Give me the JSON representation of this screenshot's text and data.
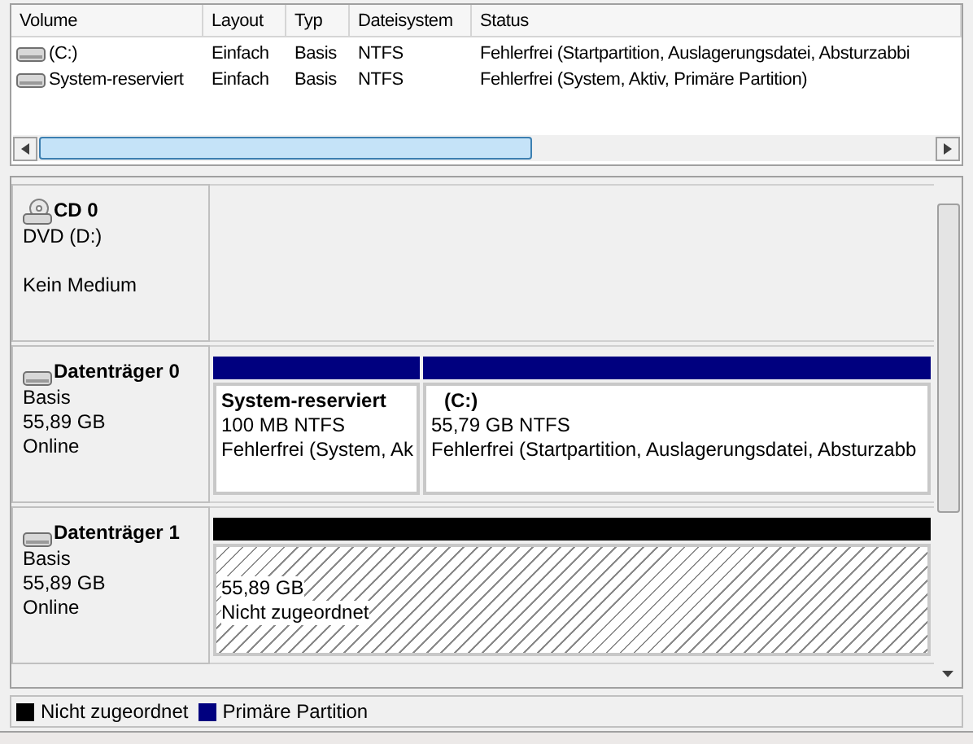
{
  "volume_list": {
    "columns": [
      "Volume",
      "Layout",
      "Typ",
      "Dateisystem",
      "Status"
    ],
    "rows": [
      [
        "(C:)",
        "Einfach",
        "Basis",
        "NTFS",
        "Fehlerfrei (Startpartition, Auslagerungsdatei, Absturzabbi"
      ],
      [
        "System-reserviert",
        "Einfach",
        "Basis",
        "NTFS",
        "Fehlerfrei (System, Aktiv, Primäre Partition)"
      ]
    ]
  },
  "disks": [
    {
      "kind": "cdrom",
      "name": "CD 0",
      "lines": [
        "DVD (D:)",
        "Kein Medium"
      ]
    },
    {
      "kind": "disk",
      "name": "Datenträger 0",
      "lines": [
        "Basis",
        "55,89 GB",
        "Online"
      ],
      "partitions": [
        {
          "kind": "primary",
          "color": "#00007f",
          "title": "System-reserviert",
          "size": "100 MB NTFS",
          "status": "Fehlerfrei (System, Ak"
        },
        {
          "kind": "primary",
          "color": "#00007f",
          "title": "(C:)",
          "size": "55,79 GB NTFS",
          "status": "Fehlerfrei (Startpartition, Auslagerungsdatei, Absturzabb"
        }
      ]
    },
    {
      "kind": "disk",
      "name": "Datenträger 1",
      "lines": [
        "Basis",
        "55,89 GB",
        "Online"
      ],
      "partitions": [
        {
          "kind": "unallocated",
          "color": "#000000",
          "size": "55,89 GB",
          "status": "Nicht zugeordnet"
        }
      ]
    }
  ],
  "legend": [
    {
      "label": "Nicht zugeordnet",
      "color": "#000000"
    },
    {
      "label": "Primäre Partition",
      "color": "#00007f"
    }
  ]
}
